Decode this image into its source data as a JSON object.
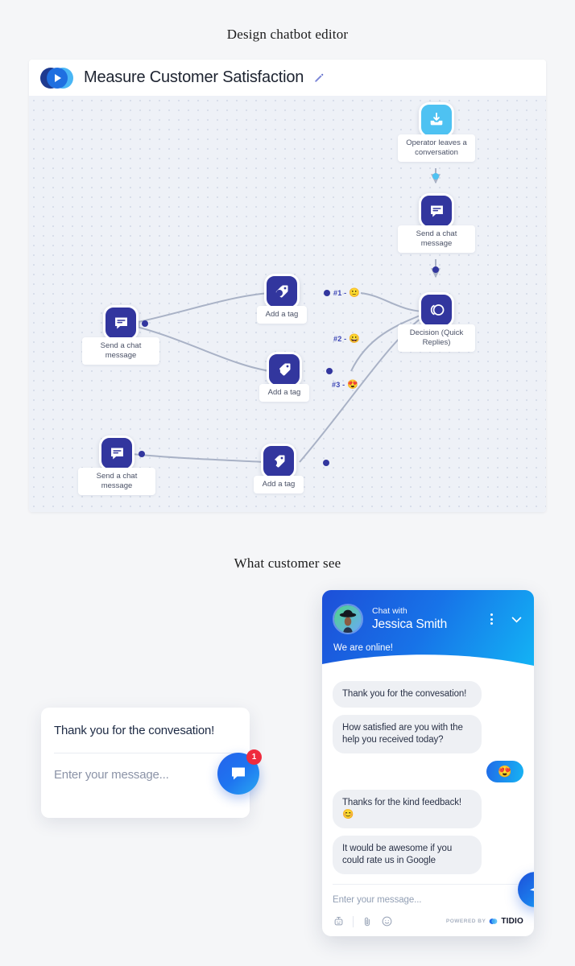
{
  "headings": {
    "design": "Design chatbot editor",
    "customer": "What customer see"
  },
  "editor": {
    "logo_icon": "tidio-logo-icon",
    "title": "Measure Customer Satisfaction",
    "edit_icon": "pencil-icon",
    "nodes": [
      {
        "id": "trigger",
        "icon": "inbox-download-icon",
        "label": "Operator leaves a conversation",
        "color": "#4ec2f2"
      },
      {
        "id": "msg1",
        "icon": "chat-message-icon",
        "label": "Send a chat message",
        "color": "#32369e"
      },
      {
        "id": "decision",
        "icon": "quick-replies-icon",
        "label": "Decision (Quick Replies)",
        "color": "#32369e"
      },
      {
        "id": "tag1",
        "icon": "tag-icon",
        "label": "Add a tag",
        "color": "#32369e"
      },
      {
        "id": "tag2",
        "icon": "tag-icon",
        "label": "Add a tag",
        "color": "#32369e"
      },
      {
        "id": "tag3",
        "icon": "tag-icon",
        "label": "Add a tag",
        "color": "#32369e"
      },
      {
        "id": "msg2",
        "icon": "chat-message-icon",
        "label": "Send a chat message",
        "color": "#32369e"
      },
      {
        "id": "msg3",
        "icon": "chat-message-icon",
        "label": "Send a chat message",
        "color": "#32369e"
      }
    ],
    "branches": [
      {
        "text": "#1 - ",
        "emoji": "🙂"
      },
      {
        "text": "#2 - ",
        "emoji": "😀"
      },
      {
        "text": "#3 - ",
        "emoji": "😍"
      }
    ]
  },
  "mini_card": {
    "message": "Thank you for the convesation!",
    "input_placeholder": "Enter your message...",
    "launcher_icon": "chat-bubble-icon",
    "badge_count": "1"
  },
  "widget": {
    "avatar_icon": "avatar-jessica-smith",
    "chat_with_label": "Chat with",
    "agent_name": "Jessica Smith",
    "menu_icon": "kebab-menu-icon",
    "collapse_icon": "chevron-down-icon",
    "status": "We are online!",
    "messages": [
      {
        "from": "bot",
        "text": "Thank you for the convesation!"
      },
      {
        "from": "bot",
        "text": "How satisfied are you with the help you received today?"
      },
      {
        "from": "user",
        "text": "😍"
      },
      {
        "from": "bot",
        "text": "Thanks for the kind feedback! 😊"
      },
      {
        "from": "bot",
        "text": "It would be awesome if you could rate us in Google"
      }
    ],
    "input_placeholder": "Enter your message...",
    "tools": [
      {
        "icon": "bot-icon"
      },
      {
        "icon": "paperclip-icon"
      },
      {
        "icon": "emoji-smiley-icon"
      }
    ],
    "powered_by_label": "POWERED BY",
    "brand_name": "TIDIO",
    "brand_icon": "tidio-logo-icon",
    "send_icon": "send-paper-plane-icon"
  },
  "colors": {
    "page_bg": "#f5f6f8",
    "canvas_bg": "#eef1f7",
    "node_navy": "#32369e",
    "node_sky": "#4ec2f2",
    "brand_blue": "#1f6ae8",
    "badge_red": "#ef2b3d"
  }
}
